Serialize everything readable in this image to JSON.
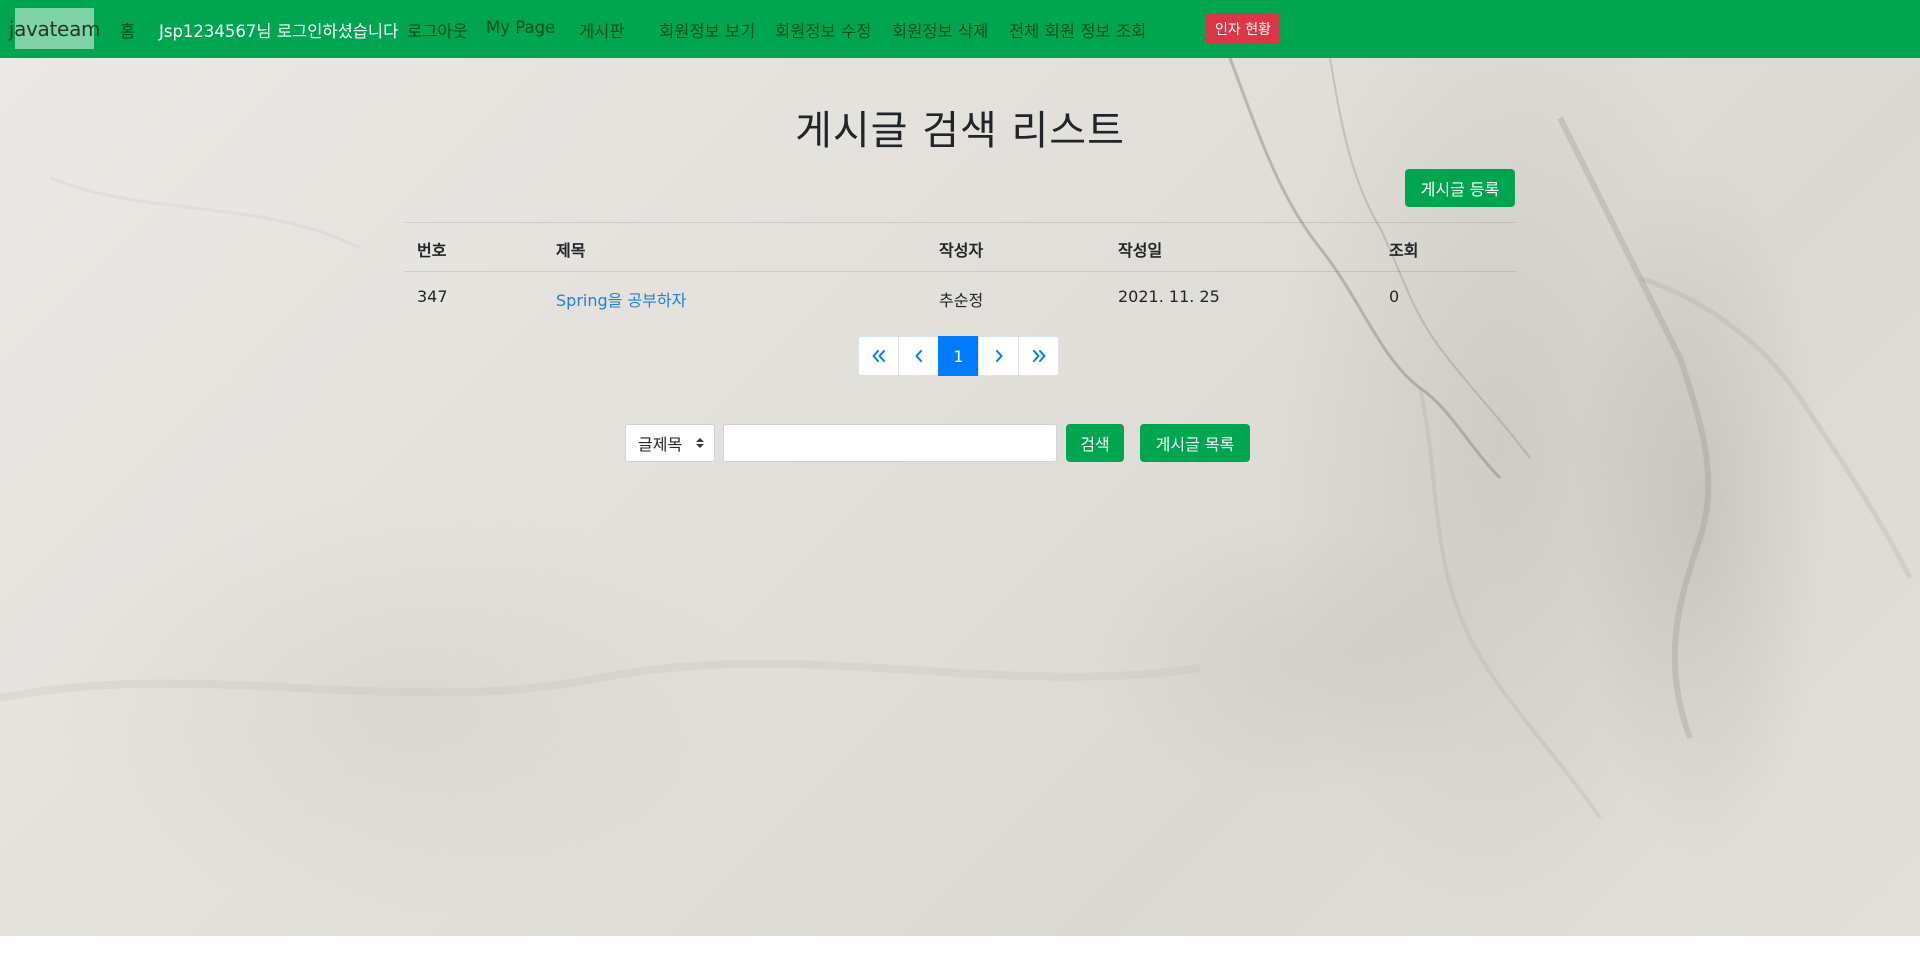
{
  "nav": {
    "brand": "javateam",
    "home": "홈",
    "user_greeting": "Jsp1234567님 로그인하셨습니다",
    "logout": "로그아웃",
    "mypage": "My Page",
    "board": "게시판",
    "member_view": "회원정보 보기",
    "member_edit": "회원정보 수정",
    "member_delete": "회원정보 삭제",
    "member_all": "전체 회원 정보 조회",
    "status_badge": "인자 현황"
  },
  "main": {
    "title": "게시글 검색 리스트",
    "register_button": "게시글 등록"
  },
  "table": {
    "headers": [
      "번호",
      "제목",
      "작성자",
      "작성일",
      "조회"
    ],
    "rows": [
      {
        "no": "347",
        "title": "Spring을 공부하자",
        "writer": "추순정",
        "date": "2021. 11. 25",
        "views": "0"
      }
    ]
  },
  "pagination": {
    "first": "«",
    "prev": "‹",
    "current": "1",
    "next": "›",
    "last": "»"
  },
  "search": {
    "field_selected": "글제목",
    "query_value": "",
    "search_button": "검색",
    "list_button": "게시글 목록"
  },
  "colors": {
    "navbar": "#00a64f",
    "primary_button": "#00a64f",
    "badge": "#dc3545",
    "pagination_active": "#007bff",
    "link": "#1f7fe0"
  }
}
